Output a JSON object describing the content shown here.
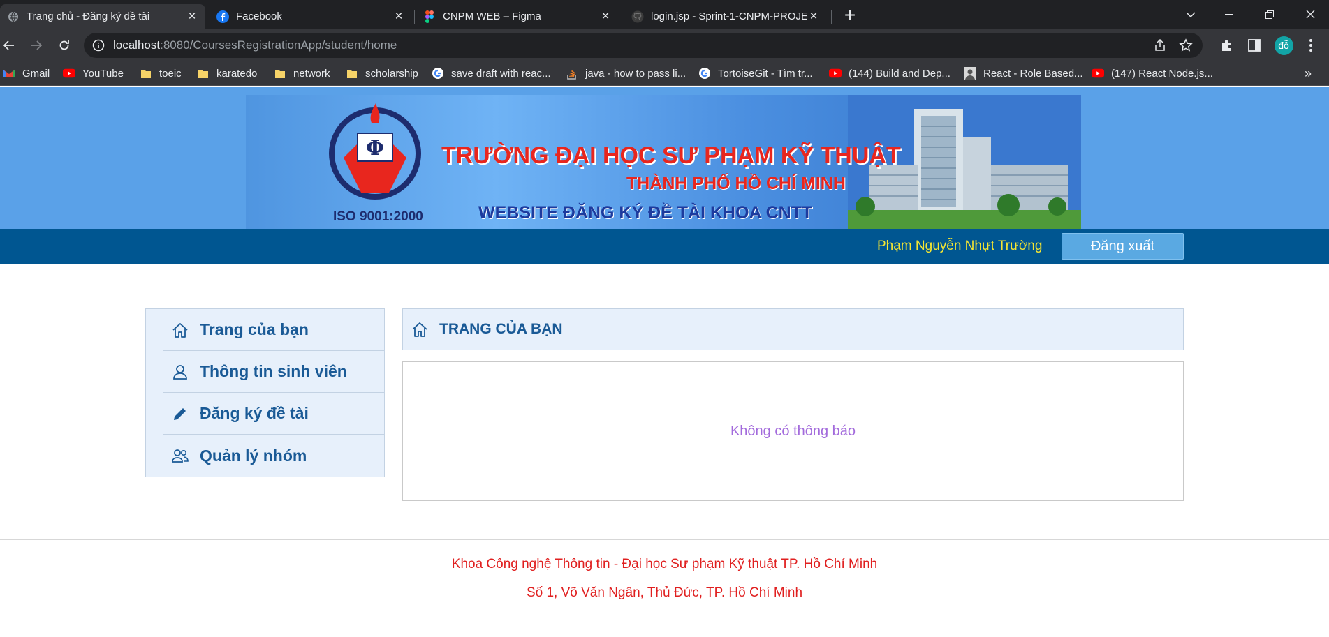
{
  "browser": {
    "tabs": [
      {
        "title": "Trang chủ - Đăng ký đề tài",
        "icon": "globe-icon",
        "active": true
      },
      {
        "title": "Facebook",
        "icon": "facebook-icon",
        "active": false
      },
      {
        "title": "CNPM WEB – Figma",
        "icon": "figma-icon",
        "active": false
      },
      {
        "title": "login.jsp - Sprint-1-CNPM-PROJE",
        "icon": "github-icon",
        "active": false
      }
    ],
    "new_tab_label": "+",
    "url_host": "localhost",
    "url_rest": ":8080/CoursesRegistrationApp/student/home",
    "profile_initials": "đỗ",
    "bookmarks": [
      {
        "label": "Gmail",
        "icon": "gmail-icon"
      },
      {
        "label": "YouTube",
        "icon": "youtube-icon"
      },
      {
        "label": "toeic",
        "icon": "folder-icon"
      },
      {
        "label": "karatedo",
        "icon": "folder-icon"
      },
      {
        "label": "network",
        "icon": "folder-icon"
      },
      {
        "label": "scholarship",
        "icon": "folder-icon"
      },
      {
        "label": "save draft with reac...",
        "icon": "google-icon"
      },
      {
        "label": "java - how to pass li...",
        "icon": "stackoverflow-icon"
      },
      {
        "label": "TortoiseGit - Tìm tr...",
        "icon": "google-icon"
      },
      {
        "label": "(144) Build and Dep...",
        "icon": "youtube-icon"
      },
      {
        "label": "React - Role Based...",
        "icon": "avatar-icon"
      },
      {
        "label": "(147) React Node.js...",
        "icon": "youtube-icon"
      }
    ],
    "bookmarks_overflow": "»"
  },
  "banner": {
    "line1": "TRƯỜNG ĐẠI HỌC SƯ PHẠM KỸ THUẬT",
    "line2": "THÀNH PHỐ HỒ CHÍ MINH",
    "line3": "WEBSITE ĐĂNG KÝ ĐỀ TÀI KHOA CNTT",
    "iso": "ISO 9001:2000",
    "logo_letter": "Φ"
  },
  "navbar": {
    "username": "Phạm Nguyễn Nhựt Trường",
    "logout_label": "Đăng xuất"
  },
  "sidebar": {
    "items": [
      {
        "label": "Trang của bạn",
        "icon": "home-icon"
      },
      {
        "label": "Thông tin sinh viên",
        "icon": "user-icon"
      },
      {
        "label": "Đăng ký đề tài",
        "icon": "pencil-icon"
      },
      {
        "label": "Quản lý nhóm",
        "icon": "group-icon"
      }
    ]
  },
  "content": {
    "heading": "TRANG CỦA BẠN",
    "empty_message": "Không có thông báo"
  },
  "footer": {
    "line1": "Khoa Công nghệ Thông tin - Đại học Sư phạm Kỹ thuật TP. Hồ Chí Minh",
    "line2": "Số 1, Võ Văn Ngân, Thủ Đức, TP. Hồ Chí Minh"
  },
  "colors": {
    "navbar": "#005691",
    "username": "#f5e632",
    "logout_button": "#5aa9e2",
    "sidebar_bg": "#e7f0fb",
    "sidebar_text": "#1a5a96",
    "message": "#a36bdc",
    "footer_text": "#e02020"
  }
}
